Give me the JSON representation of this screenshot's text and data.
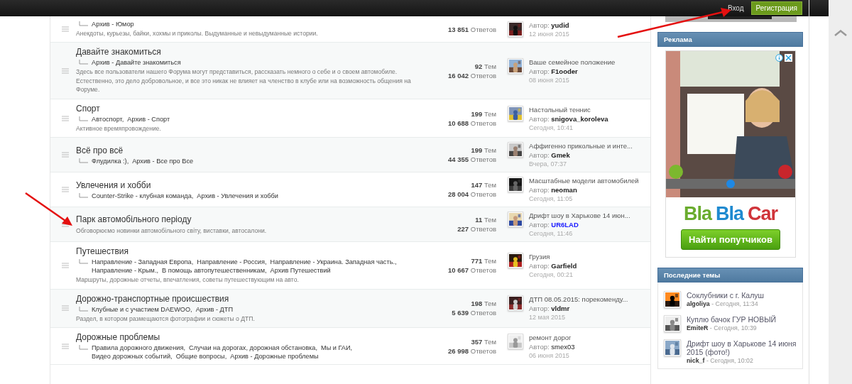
{
  "top_bar": {
    "login": "Вход",
    "register": "Регистрация"
  },
  "forums": [
    {
      "subforums": [
        "Архив - Юмор"
      ],
      "description": "Анекдоты, курьезы, байки, хохмы и приколы. Выдуманные и невыдуманные истории.",
      "stats": [
        "**13 851** Ответов"
      ],
      "last_post": {
        "author_prefix": "Автор:",
        "author": "yudid",
        "author_bold": true,
        "date": "12 июня 2015"
      }
    },
    {
      "title": "Давайте знакомиться",
      "subforums": [
        "Архив - Давайте знакомиться"
      ],
      "description": "Здесь все пользователи нашего Форума могут представиться, рассказать немного о себе и о своем автомобиле. Естественно, это дело добровольное, и все это никак не влияет на членство в клубе или на возможность общения на Форуме.",
      "stats": [
        "**92** Тем",
        "**16 042** Ответов"
      ],
      "last_post": {
        "topic": "Ваше семейное положение",
        "author_prefix": "Автор:",
        "author": "F1ooder",
        "author_bold": true,
        "date": "08 июня 2015"
      }
    },
    {
      "title": "Спорт",
      "subforums": [
        "Автоспорт,",
        "Архив - Спорт"
      ],
      "description": "Активное времяпровождение.",
      "stats": [
        "**199** Тем",
        "**10 688** Ответов"
      ],
      "last_post": {
        "topic": "Настольный теннис",
        "author_prefix": "Автор:",
        "author": "snigova_koroleva",
        "author_bold": true,
        "date": "Сегодня, 10:41"
      }
    },
    {
      "title": "Всё про всё",
      "subforums": [
        "Флудилка :),",
        "Архив - Все про Все"
      ],
      "stats": [
        "**199** Тем",
        "**44 355** Ответов"
      ],
      "last_post": {
        "topic": "Аффигенно прикольные и инте...",
        "author_prefix": "Автор:",
        "author": "Gmek",
        "author_bold": true,
        "date": "Вчера, 07:37"
      }
    },
    {
      "title": "Увлечения и хобби",
      "subforums": [
        "Counter-Strike - клубная команда,",
        "Архив - Увлечения и хобби"
      ],
      "stats": [
        "**147** Тем",
        "**28 004** Ответов"
      ],
      "last_post": {
        "topic": "Масштабные модели автомобилей",
        "author_prefix": "Автор:",
        "author": "neoman",
        "author_bold": true,
        "date": "Сегодня, 11:05"
      }
    },
    {
      "title": "Парк автомобільного періоду",
      "description": "Обговорюємо новинки автомобільного світу, виставки, автосалони.",
      "stats": [
        "**11** Тем",
        "**227** Ответов"
      ],
      "last_post": {
        "topic": "Дрифт шоу в Харькове 14 июн...",
        "author_prefix": "Автор:",
        "author": "UR6LAD",
        "author_bold": true,
        "color": "#1a1aff",
        "date": "Сегодня, 11:46"
      }
    },
    {
      "title": "Путешествия",
      "subforums": [
        "Направление - Западная Европа,",
        "Направление - Россия,",
        "Направление - Украина. Западная часть.,",
        "Направление - Крым.,",
        "В помощь автопутешественникам,",
        "Архив Путешествий"
      ],
      "description": "Маршруты, дорожные отчеты, впечатления, советы путешествующим на авто.",
      "stats": [
        "**771** Тем",
        "**10 667** Ответов"
      ],
      "last_post": {
        "topic": "Грузия",
        "author_prefix": "Автор:",
        "author": "Garfield",
        "author_bold": true,
        "date": "Сегодня, 00:21"
      }
    },
    {
      "title": "Дорожно-транспортные происшествия",
      "subforums": [
        "Клубные и с участием DAEWOO,",
        "Архив - ДТП"
      ],
      "description": "Раздел, в котором размещаются фотографии и сюжеты о ДТП.",
      "stats": [
        "**198** Тем",
        "**5 639** Ответов"
      ],
      "last_post": {
        "topic": "ДТП 08.05.2015: порекоменду...",
        "author_prefix": "Автор:",
        "author": "vldmr",
        "author_bold": true,
        "date": "12 мая 2015"
      }
    },
    {
      "title": "Дорожные проблемы",
      "subforums": [
        "Правила дорожного движения,",
        "Случаи на дорогах, дорожная обстановка,",
        "Мы и ГАИ,",
        "Видео дорожных событий,",
        "Общие вопросы,",
        "Архив - Дорожные проблемы"
      ],
      "stats": [
        "**357** Тем",
        "**26 998** Ответов"
      ],
      "last_post": {
        "topic": "ремонт дорог",
        "author_prefix": "Автор:",
        "author": "smex03",
        "author_bold": false,
        "date": "06 июня 2015"
      }
    }
  ],
  "sidebar": {
    "ad": {
      "header": "Реклама",
      "logo": [
        {
          "text": "Bla",
          "color": "#6aac2e"
        },
        {
          "text": "Bla",
          "color": "#1f8ad0"
        },
        {
          "text": "Car",
          "color": "#d0343a"
        }
      ],
      "button": "Найти попутчиков"
    },
    "recent": {
      "header": "Последние темы",
      "items": [
        {
          "title": "Соклубники с г. Калуш",
          "meta": "**algoliya** - Сегодня, 11:34"
        },
        {
          "title": "Куплю бачок ГУР НОВЫЙ",
          "meta": "**EmiteR** - Сегодня, 10:39"
        },
        {
          "title": "Дрифт шоу в Харькове 14 июня 2015 (фото!)",
          "meta": "**nick_f** - Сегодня, 10:02"
        }
      ]
    }
  }
}
